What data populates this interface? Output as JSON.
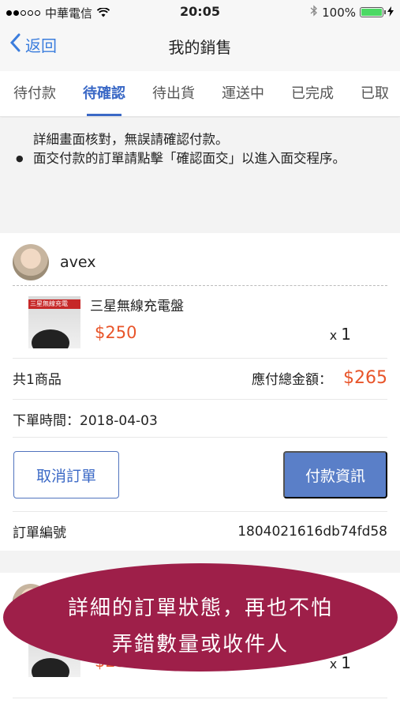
{
  "status_bar": {
    "carrier": "中華電信",
    "time": "20:05",
    "battery": "100%"
  },
  "nav": {
    "back_label": "返回",
    "title": "我的銷售"
  },
  "tabs": [
    {
      "label": "待付款"
    },
    {
      "label": "待確認"
    },
    {
      "label": "待出貨"
    },
    {
      "label": "運送中"
    },
    {
      "label": "已完成"
    },
    {
      "label": "已取"
    }
  ],
  "notice": {
    "fragment": "詳細畫面核對，無誤請確認付款。",
    "bullet": "面交付款的訂單請點擊「確認面交」以進入面交程序。"
  },
  "order1": {
    "seller": "avex",
    "product_name": "三星無線充電盤",
    "price": "$250",
    "qty_prefix": "x",
    "qty": "1",
    "item_count": "共1商品",
    "total_label": "應付總金額：",
    "total_amount": "$265",
    "order_time": "下單時間：2018-04-03",
    "cancel_label": "取消訂單",
    "pay_info_label": "付款資訊",
    "order_no_label": "訂單編號",
    "order_no": "1804021616db74fd58"
  },
  "order2": {
    "price": "$250",
    "qty_prefix": "x",
    "qty": "1"
  },
  "thumb_text": "三星無線充電",
  "promo": {
    "line1": "詳細的訂單狀態，再也不怕",
    "line2": "弄錯數量或收件人"
  },
  "colors": {
    "accent": "#3b69c6",
    "price": "#e8552a",
    "promo_bg": "#9e1f49"
  }
}
